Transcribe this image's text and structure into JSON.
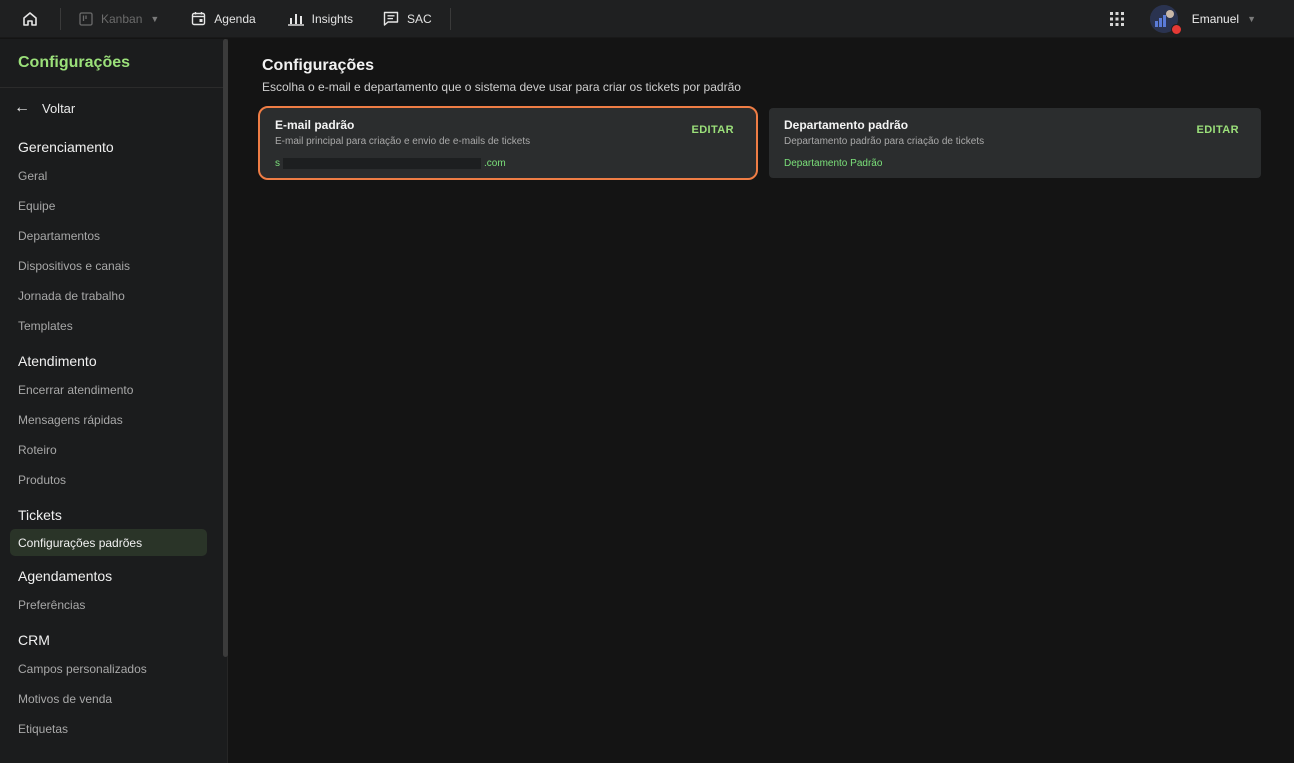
{
  "topbar": {
    "kanban_label": "Kanban",
    "agenda_label": "Agenda",
    "insights_label": "Insights",
    "sac_label": "SAC",
    "user_name": "Emanuel"
  },
  "sidebar": {
    "title": "Configurações",
    "back_label": "Voltar",
    "groups": [
      {
        "title": "Gerenciamento",
        "items": [
          "Geral",
          "Equipe",
          "Departamentos",
          "Dispositivos e canais",
          "Jornada de trabalho",
          "Templates"
        ]
      },
      {
        "title": "Atendimento",
        "items": [
          "Encerrar atendimento",
          "Mensagens rápidas",
          "Roteiro",
          "Produtos"
        ]
      },
      {
        "title": "Tickets",
        "items": [
          "Configurações padrões"
        ]
      },
      {
        "title": "Agendamentos",
        "items": [
          "Preferências"
        ]
      },
      {
        "title": "CRM",
        "items": [
          "Campos personalizados",
          "Motivos de venda",
          "Etiquetas"
        ]
      }
    ]
  },
  "main": {
    "title": "Configurações",
    "subtitle": "Escolha o e-mail e departamento que o sistema deve usar para criar os tickets por padrão",
    "cards": [
      {
        "title": "E-mail padrão",
        "description": "E-mail principal para criação e envio de e-mails de tickets",
        "value_prefix": "s",
        "value_suffix": ".com",
        "action": "EDITAR"
      },
      {
        "title": "Departamento padrão",
        "description": "Departamento padrão para criação de tickets",
        "value": "Departamento Padrão",
        "action": "EDITAR"
      }
    ]
  },
  "colors": {
    "accent_green": "#9be07a",
    "selected_outline": "#ef7d45",
    "background": "#141414"
  }
}
